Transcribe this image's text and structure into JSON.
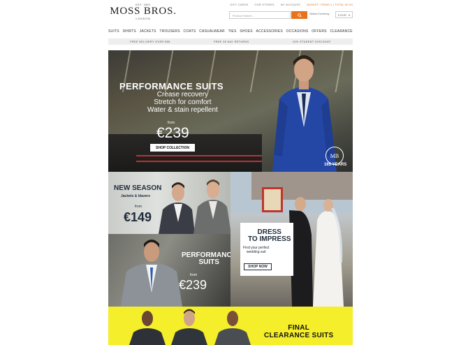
{
  "header": {
    "top_links": [
      "GIFT CARDS",
      "OUR STORES",
      "MY ACCOUNT"
    ],
    "basket": "BASKET: ITEMS 0 | TOTAL €0.00",
    "logo": {
      "est": "EST. 1851",
      "name": "MOSS BROS.",
      "city": "LONDON"
    },
    "search": {
      "placeholder": "Product Search..."
    },
    "currency": {
      "label": "Select Currency",
      "value": "€ EUR"
    }
  },
  "nav": {
    "items": [
      "SUITS",
      "SHIRTS",
      "JACKETS",
      "TROUSERS",
      "COATS",
      "CASUALWEAR",
      "TIES",
      "SHOES",
      "ACCESSORIES",
      "OCCASIONS",
      "OFFERS",
      "CLEARANCE"
    ]
  },
  "promo": {
    "items": [
      "FREE DELIVERY OVER €85",
      "FREE 28 DAY RETURNS",
      "15% STUDENT DISCOUNT"
    ]
  },
  "hero": {
    "title": "PERFORMANCE SUITS",
    "features": [
      "Crease recovery",
      "Stretch for comfort",
      "Water & stain repellent"
    ],
    "from": "from",
    "price": "€239",
    "cta": "SHOP COLLECTION",
    "badge": "MB",
    "years": "165 YEARS"
  },
  "tiles": {
    "new_season": {
      "title": "NEW SEASON",
      "sub": "Jackets & blazers",
      "from": "from",
      "price": "€149"
    },
    "performance": {
      "title_1": "PERFORMANCE",
      "title_2": "SUITS",
      "from": "from",
      "price": "€239"
    },
    "dress": {
      "title_1": "DRESS",
      "title_2": "TO IMPRESS",
      "sub_1": "Find your perfect",
      "sub_2": "wedding suit",
      "cta": "SHOP NOW"
    },
    "clearance": {
      "title_1": "FINAL",
      "title_2": "CLEARANCE SUITS"
    }
  },
  "colors": {
    "accent": "#e8731c",
    "navy": "#1d2a38",
    "yellow": "#f5ee2a"
  }
}
